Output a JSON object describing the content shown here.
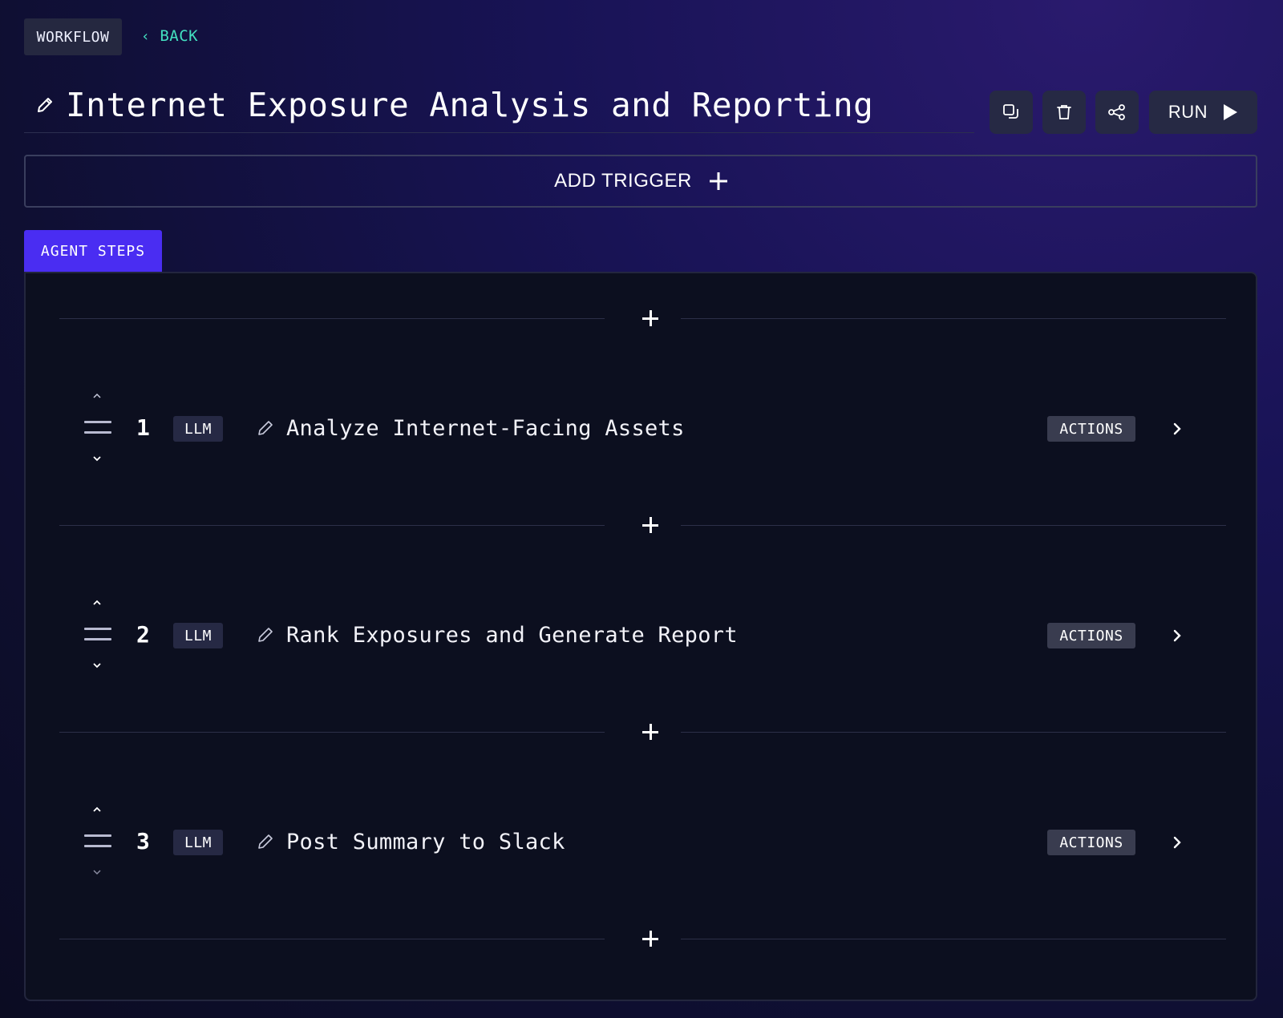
{
  "header": {
    "breadcrumb_tag": "WORKFLOW",
    "back_label": "BACK",
    "title": "Internet Exposure Analysis and Reporting",
    "run_label": "RUN"
  },
  "toolbar": {
    "icons": [
      "copy-icon",
      "trash-icon",
      "share-icon",
      "play-icon"
    ]
  },
  "trigger": {
    "label": "ADD TRIGGER"
  },
  "tabs": [
    {
      "label": "AGENT STEPS",
      "active": true
    }
  ],
  "steps": [
    {
      "number": "1",
      "type": "LLM",
      "title": "Analyze Internet-Facing Assets",
      "actions_label": "ACTIONS"
    },
    {
      "number": "2",
      "type": "LLM",
      "title": "Rank Exposures and Generate Report",
      "actions_label": "ACTIONS"
    },
    {
      "number": "3",
      "type": "LLM",
      "title": "Post Summary to Slack",
      "actions_label": "ACTIONS"
    }
  ],
  "colors": {
    "accent": "#4a2df2",
    "back_link": "#43e0c0",
    "panel_bg": "#0c0f1f",
    "button_bg": "#262944"
  }
}
